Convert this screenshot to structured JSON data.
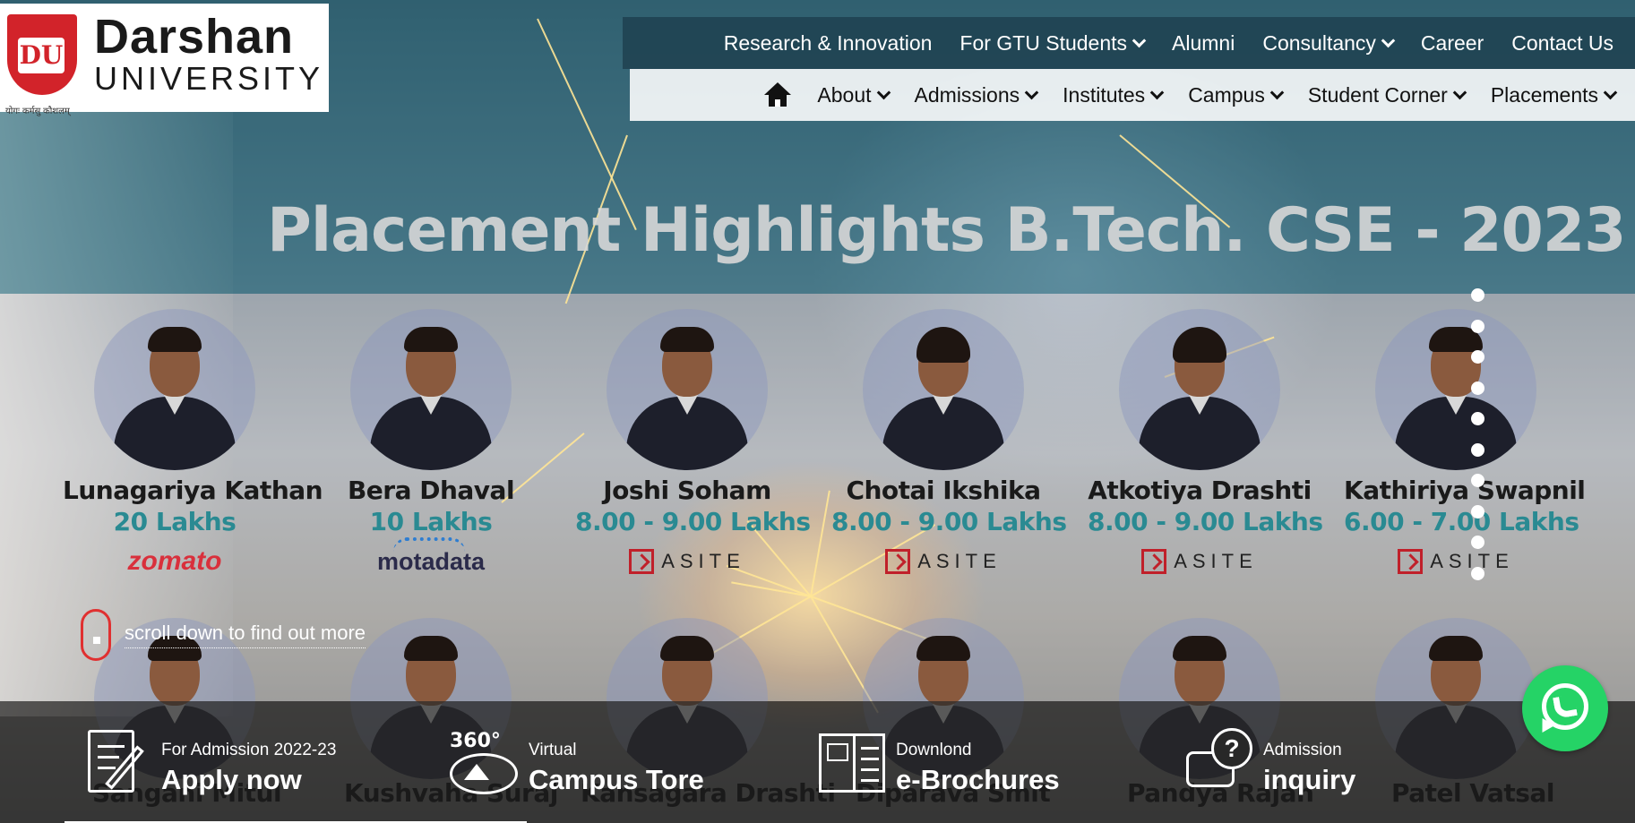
{
  "logo": {
    "line1": "Darshan",
    "line2": "UNIVERSITY",
    "mark": "DU",
    "motto": "योगः कर्मसु कौशलम्"
  },
  "nav_top": [
    {
      "label": "Research & Innovation",
      "dropdown": false
    },
    {
      "label": "For GTU Students",
      "dropdown": true
    },
    {
      "label": "Alumni",
      "dropdown": false
    },
    {
      "label": "Consultancy",
      "dropdown": true
    },
    {
      "label": "Career",
      "dropdown": false
    },
    {
      "label": "Contact Us",
      "dropdown": false
    }
  ],
  "nav_bottom": [
    {
      "label": "About",
      "dropdown": true
    },
    {
      "label": "Admissions",
      "dropdown": true
    },
    {
      "label": "Institutes",
      "dropdown": true
    },
    {
      "label": "Campus",
      "dropdown": true
    },
    {
      "label": "Student Corner",
      "dropdown": true
    },
    {
      "label": "Placements",
      "dropdown": true
    }
  ],
  "hero": {
    "title": "Placement Highlights B.Tech. CSE - 2023",
    "students": [
      {
        "name": "Lunagariya Kathan",
        "package": "20 Lakhs",
        "company": "zomato",
        "company_style": "zomato"
      },
      {
        "name": "Bera Dhaval",
        "package": "10 Lakhs",
        "company": "motadata",
        "company_style": "motadata"
      },
      {
        "name": "Joshi Soham",
        "package": "8.00 - 9.00 Lakhs",
        "company": "ASITE",
        "company_style": "asite"
      },
      {
        "name": "Chotai Ikshika",
        "package": "8.00 - 9.00 Lakhs",
        "company": "ASITE",
        "company_style": "asite"
      },
      {
        "name": "Atkotiya Drashti",
        "package": "8.00 - 9.00 Lakhs",
        "company": "ASITE",
        "company_style": "asite"
      },
      {
        "name": "Kathiriya Swapnil",
        "package": "6.00 - 7.00 Lakhs",
        "company": "ASITE",
        "company_style": "asite"
      }
    ],
    "row2_names": [
      "Sangani Mitul",
      "Kushvaha Suraj",
      "Kansagara Drashti",
      "Diparava Smit",
      "Pandya Rajan",
      "Patel Vatsal"
    ],
    "slider_dot_count": 10,
    "scroll_hint": "scroll down to find out more"
  },
  "cta": [
    {
      "small": "For Admission 2022-23",
      "big": "Apply now",
      "icon": "application-form-icon"
    },
    {
      "small": "Virtual",
      "big": "Campus Tore",
      "icon": "virtual-tour-360-icon"
    },
    {
      "small": "Downlond",
      "big": "e-Brochures",
      "icon": "brochure-icon"
    },
    {
      "small": "Admission",
      "big": "inquiry",
      "icon": "inquiry-chat-icon"
    }
  ],
  "colors": {
    "brand_red": "#d2232a",
    "nav_dark": "#1e4150",
    "package_teal": "#2a8a92",
    "whatsapp_green": "#25d366"
  }
}
